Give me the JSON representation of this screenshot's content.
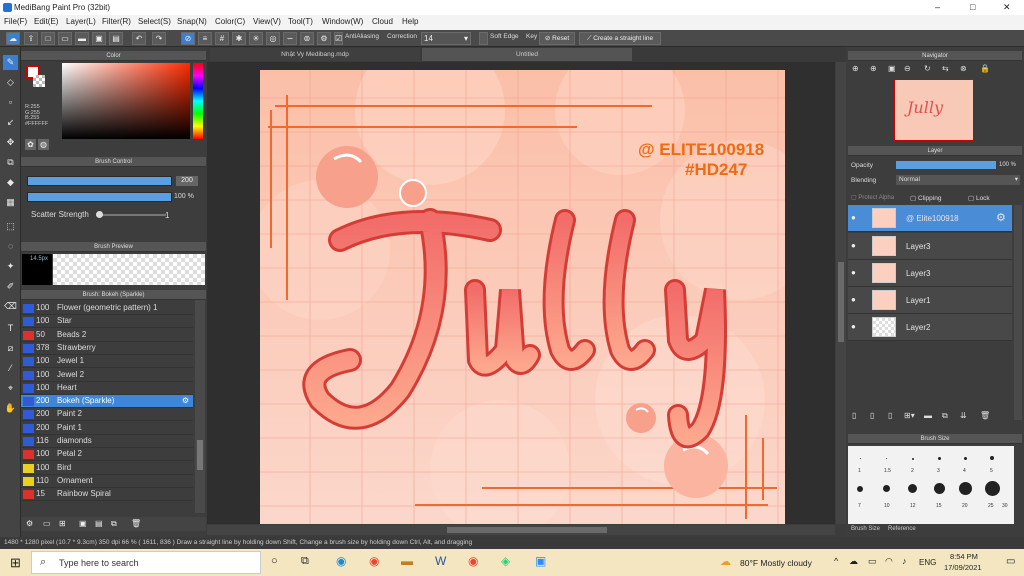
{
  "window": {
    "title": "MediBang Paint Pro (32bit)",
    "controls": [
      "–",
      "□",
      "✕"
    ]
  },
  "menu": [
    "File(F)",
    "Edit(E)",
    "Layer(L)",
    "Filter(R)",
    "Select(S)",
    "Snap(N)",
    "Color(C)",
    "View(V)",
    "Tool(T)",
    "Window(W)",
    "Cloud",
    "Help"
  ],
  "toolbar": {
    "antialias": "AntiAliasing",
    "correction_label": "Correction",
    "correction_value": "14",
    "soft_edge": "Soft Edge",
    "key": "Key",
    "reset": "Reset",
    "straight_line": "Create a straight line"
  },
  "tabs": [
    "Nhật Vy Medibang.mdp",
    "Untitled"
  ],
  "color_panel": {
    "title": "Color",
    "r": "R:255",
    "g": "G:255",
    "b": "B:255",
    "hex": "#FFFFFF"
  },
  "brush_control": {
    "title": "Brush Control",
    "size": "200",
    "opacity": "100 %",
    "scatter_label": "Scatter Strength",
    "scatter_value": "1"
  },
  "brush_preview": {
    "title": "Brush Preview",
    "size": "14.5px"
  },
  "brush_list": {
    "title": "Brush: Bokeh (Sparkle)",
    "items": [
      {
        "n": "100",
        "l": "Flower (geometric pattern) 1",
        "c": "#2f5bd8"
      },
      {
        "n": "100",
        "l": "Star",
        "c": "#2f5bd8"
      },
      {
        "n": "50",
        "l": "Beads 2",
        "c": "#e0302a"
      },
      {
        "n": "378",
        "l": "Strawberry",
        "c": "#2f5bd8"
      },
      {
        "n": "100",
        "l": "Jewel 1",
        "c": "#2f5bd8"
      },
      {
        "n": "100",
        "l": "Jewel 2",
        "c": "#2f5bd8"
      },
      {
        "n": "100",
        "l": "Heart",
        "c": "#2f5bd8"
      },
      {
        "n": "200",
        "l": "Bokeh (Sparkle)",
        "c": "#2f5bd8"
      },
      {
        "n": "200",
        "l": "Paint 2",
        "c": "#2f5bd8"
      },
      {
        "n": "200",
        "l": "Paint 1",
        "c": "#2f5bd8"
      },
      {
        "n": "116",
        "l": "diamonds",
        "c": "#2f5bd8"
      },
      {
        "n": "100",
        "l": "Petal 2",
        "c": "#e0302a"
      },
      {
        "n": "100",
        "l": "Bird",
        "c": "#e8d020"
      },
      {
        "n": "110",
        "l": "Ornament",
        "c": "#e8d020"
      },
      {
        "n": "15",
        "l": "Rainbow Spiral",
        "c": "#e0302a"
      }
    ],
    "selected": 7
  },
  "artwork": {
    "handle": "@ ELITE100918",
    "tag": "#HD247",
    "word": "Jully"
  },
  "navigator": {
    "title": "Navigator"
  },
  "layer_panel": {
    "title": "Layer",
    "opacity_label": "Opacity",
    "opacity": "100 %",
    "blending_label": "Blending",
    "blending": "Normal",
    "protect_alpha": "Protect Alpha",
    "clipping": "Clipping",
    "lock": "Lock",
    "layers": [
      {
        "name": "@ Elite100918",
        "active": true
      },
      {
        "name": "Layer3",
        "active": false
      },
      {
        "name": "Layer3",
        "active": false
      },
      {
        "name": "Layer1",
        "active": false
      },
      {
        "name": "Layer2",
        "active": false
      }
    ]
  },
  "brush_size": {
    "title": "Brush Size",
    "row1": [
      "1",
      "1.5",
      "2",
      "3",
      "4",
      "5"
    ],
    "row2": [
      "7",
      "10",
      "12",
      "15",
      "20",
      "25",
      "30"
    ],
    "tabs": [
      "Brush Size",
      "Reference"
    ]
  },
  "status": "1480 * 1280 pixel   (10.7 * 9.3cm)  350 dpi   66 %   ( 1611, 836 )   Draw a straight line by holding down Shift, Change a brush size by holding down Ctrl, Alt, and dragging",
  "taskbar": {
    "search_placeholder": "Type here to search",
    "weather": "80°F  Mostly cloudy",
    "lang": "ENG",
    "time": "8:54 PM",
    "date": "17/09/2021"
  }
}
